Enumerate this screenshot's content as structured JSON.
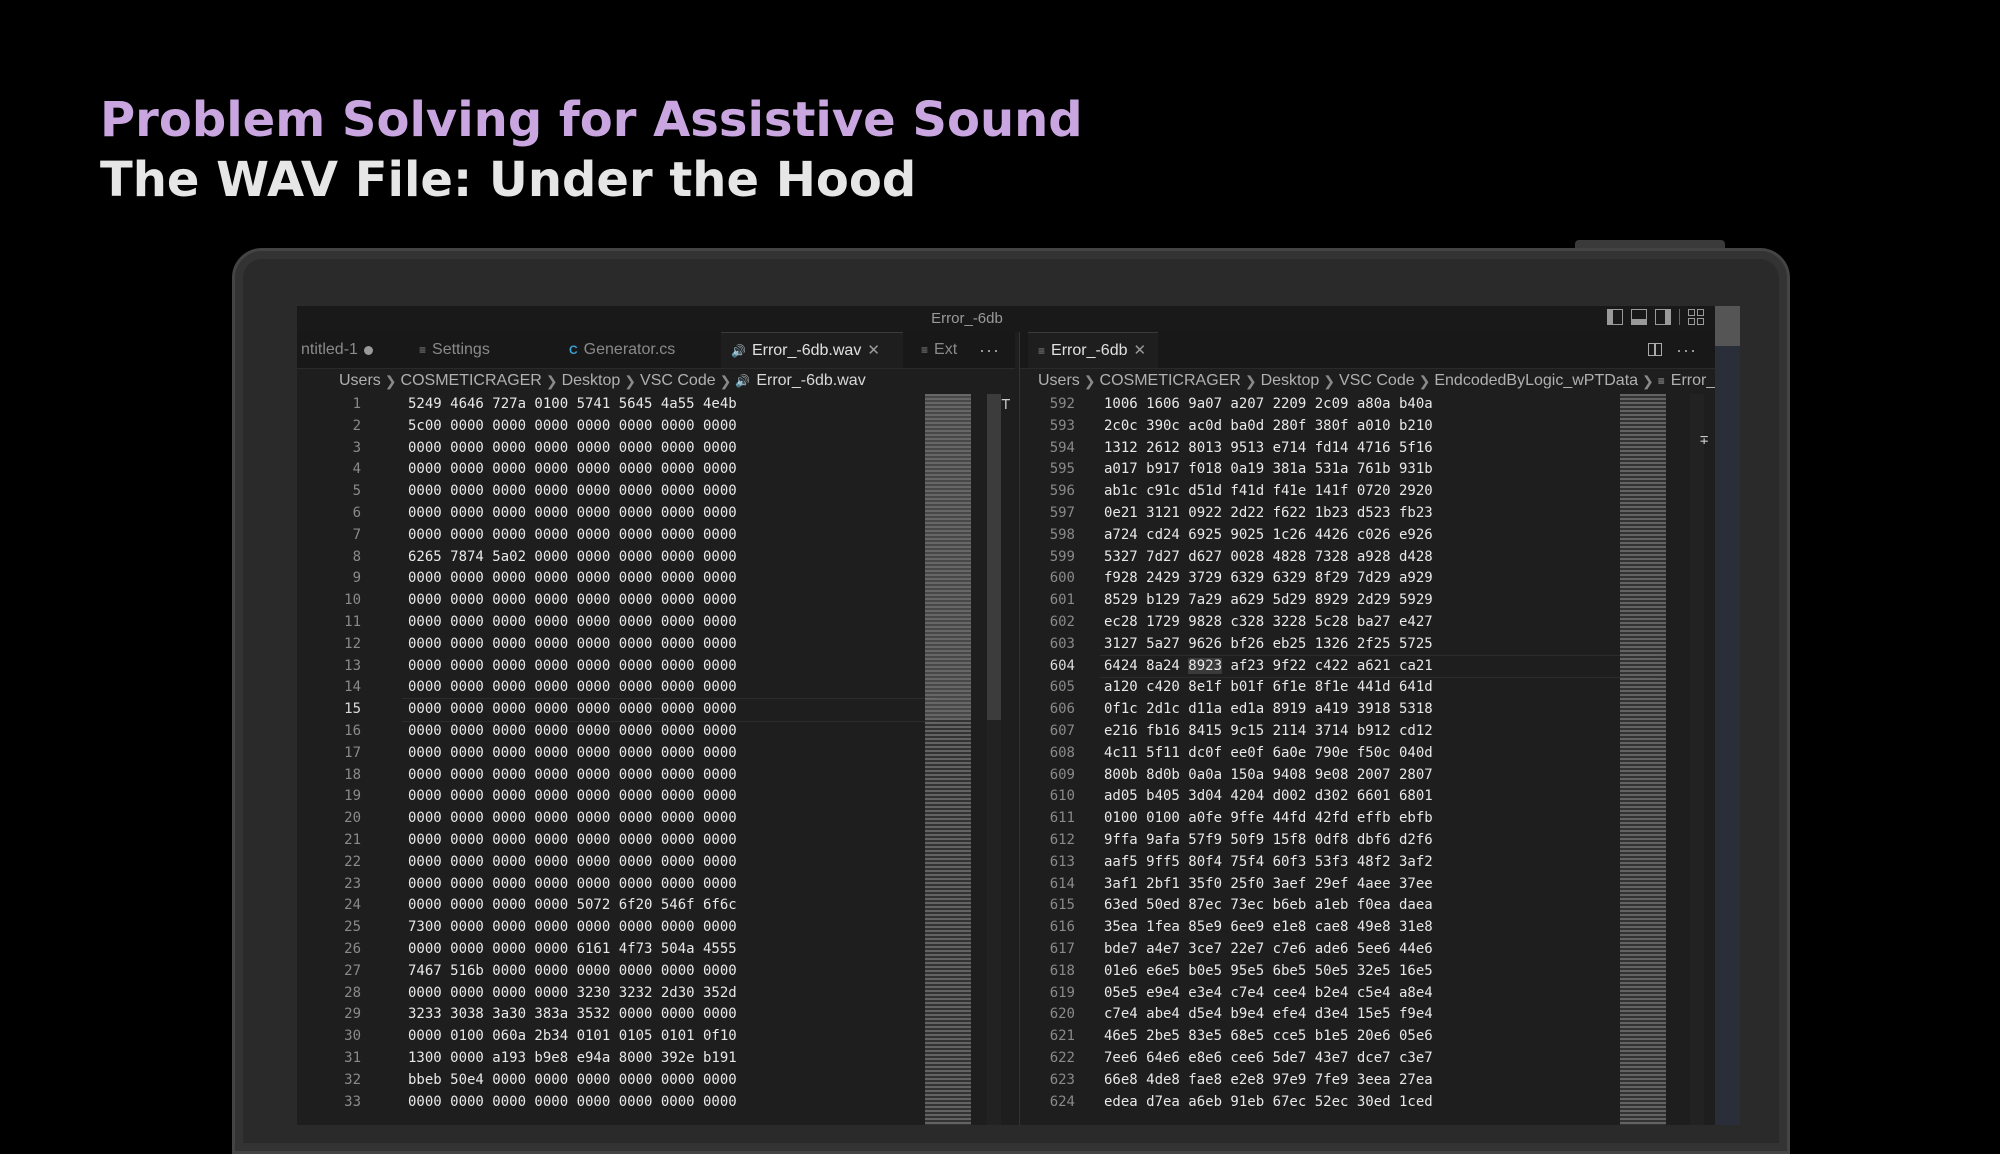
{
  "slide": {
    "title_line1": "Problem Solving for Assistive Sound",
    "title_line2": "The WAV File: Under the Hood"
  },
  "window": {
    "title": "Error_-6db"
  },
  "left_pane": {
    "tabs": [
      {
        "label": "ntitled-1",
        "icon": "unsaved-dot-icon",
        "state": "modified"
      },
      {
        "label": "Settings",
        "icon": "settings-file-icon"
      },
      {
        "label": "Generator.cs",
        "icon": "csharp-icon"
      },
      {
        "label": "Error_-6db.wav",
        "icon": "sound-icon",
        "state": "active"
      },
      {
        "label": "Ext",
        "icon": "file-lines-icon"
      }
    ],
    "more_label": "···",
    "breadcrumb": [
      "Users",
      "COSMETICRAGER",
      "Desktop",
      "VSC Code",
      "Error_-6db.wav"
    ],
    "current_line": 15,
    "lines": [
      {
        "n": "1",
        "text": "5249 4646 727a 0100 5741 5645 4a55 4e4b"
      },
      {
        "n": "2",
        "text": "5c00 0000 0000 0000 0000 0000 0000 0000"
      },
      {
        "n": "3",
        "text": "0000 0000 0000 0000 0000 0000 0000 0000"
      },
      {
        "n": "4",
        "text": "0000 0000 0000 0000 0000 0000 0000 0000"
      },
      {
        "n": "5",
        "text": "0000 0000 0000 0000 0000 0000 0000 0000"
      },
      {
        "n": "6",
        "text": "0000 0000 0000 0000 0000 0000 0000 0000"
      },
      {
        "n": "7",
        "text": "0000 0000 0000 0000 0000 0000 0000 0000"
      },
      {
        "n": "8",
        "text": "6265 7874 5a02 0000 0000 0000 0000 0000"
      },
      {
        "n": "9",
        "text": "0000 0000 0000 0000 0000 0000 0000 0000"
      },
      {
        "n": "10",
        "text": "0000 0000 0000 0000 0000 0000 0000 0000"
      },
      {
        "n": "11",
        "text": "0000 0000 0000 0000 0000 0000 0000 0000"
      },
      {
        "n": "12",
        "text": "0000 0000 0000 0000 0000 0000 0000 0000"
      },
      {
        "n": "13",
        "text": "0000 0000 0000 0000 0000 0000 0000 0000"
      },
      {
        "n": "14",
        "text": "0000 0000 0000 0000 0000 0000 0000 0000"
      },
      {
        "n": "15",
        "text": "0000 0000 0000 0000 0000 0000 0000 0000"
      },
      {
        "n": "16",
        "text": "0000 0000 0000 0000 0000 0000 0000 0000"
      },
      {
        "n": "17",
        "text": "0000 0000 0000 0000 0000 0000 0000 0000"
      },
      {
        "n": "18",
        "text": "0000 0000 0000 0000 0000 0000 0000 0000"
      },
      {
        "n": "19",
        "text": "0000 0000 0000 0000 0000 0000 0000 0000"
      },
      {
        "n": "20",
        "text": "0000 0000 0000 0000 0000 0000 0000 0000"
      },
      {
        "n": "21",
        "text": "0000 0000 0000 0000 0000 0000 0000 0000"
      },
      {
        "n": "22",
        "text": "0000 0000 0000 0000 0000 0000 0000 0000"
      },
      {
        "n": "23",
        "text": "0000 0000 0000 0000 0000 0000 0000 0000"
      },
      {
        "n": "24",
        "text": "0000 0000 0000 0000 5072 6f20 546f 6f6c"
      },
      {
        "n": "25",
        "text": "7300 0000 0000 0000 0000 0000 0000 0000"
      },
      {
        "n": "26",
        "text": "0000 0000 0000 0000 6161 4f73 504a 4555"
      },
      {
        "n": "27",
        "text": "7467 516b 0000 0000 0000 0000 0000 0000"
      },
      {
        "n": "28",
        "text": "0000 0000 0000 0000 3230 3232 2d30 352d"
      },
      {
        "n": "29",
        "text": "3233 3038 3a30 383a 3532 0000 0000 0000"
      },
      {
        "n": "30",
        "text": "0000 0100 060a 2b34 0101 0105 0101 0f10"
      },
      {
        "n": "31",
        "text": "1300 0000 a193 b9e8 e94a 8000 392e b191"
      },
      {
        "n": "32",
        "text": "bbeb 50e4 0000 0000 0000 0000 0000 0000"
      },
      {
        "n": "33",
        "text": "0000 0000 0000 0000 0000 0000 0000 0000"
      }
    ]
  },
  "right_pane": {
    "tabs": [
      {
        "label": "Error_-6db",
        "icon": "file-lines-icon",
        "state": "active"
      }
    ],
    "more_label": "···",
    "breadcrumb": [
      "Users",
      "COSMETICRAGER",
      "Desktop",
      "VSC Code",
      "EndcodedByLogic_wPTData",
      "Error_"
    ],
    "current_line": 604,
    "highlight_word": "8923",
    "lines": [
      {
        "n": "592",
        "text": "1006 1606 9a07 a207 2209 2c09 a80a b40a"
      },
      {
        "n": "593",
        "text": "2c0c 390c ac0d ba0d 280f 380f a010 b210"
      },
      {
        "n": "594",
        "text": "1312 2612 8013 9513 e714 fd14 4716 5f16"
      },
      {
        "n": "595",
        "text": "a017 b917 f018 0a19 381a 531a 761b 931b"
      },
      {
        "n": "596",
        "text": "ab1c c91c d51d f41d f41e 141f 0720 2920"
      },
      {
        "n": "597",
        "text": "0e21 3121 0922 2d22 f622 1b23 d523 fb23"
      },
      {
        "n": "598",
        "text": "a724 cd24 6925 9025 1c26 4426 c026 e926"
      },
      {
        "n": "599",
        "text": "5327 7d27 d627 0028 4828 7328 a928 d428"
      },
      {
        "n": "600",
        "text": "f928 2429 3729 6329 6329 8f29 7d29 a929"
      },
      {
        "n": "601",
        "text": "8529 b129 7a29 a629 5d29 8929 2d29 5929"
      },
      {
        "n": "602",
        "text": "ec28 1729 9828 c328 3228 5c28 ba27 e427"
      },
      {
        "n": "603",
        "text": "3127 5a27 9626 bf26 eb25 1326 2f25 5725"
      },
      {
        "n": "604",
        "text": "6424 8a24 8923 af23 9f22 c422 a621 ca21"
      },
      {
        "n": "605",
        "text": "a120 c420 8e1f b01f 6f1e 8f1e 441d 641d"
      },
      {
        "n": "606",
        "text": "0f1c 2d1c d11a ed1a 8919 a419 3918 5318"
      },
      {
        "n": "607",
        "text": "e216 fb16 8415 9c15 2114 3714 b912 cd12"
      },
      {
        "n": "608",
        "text": "4c11 5f11 dc0f ee0f 6a0e 790e f50c 040d"
      },
      {
        "n": "609",
        "text": "800b 8d0b 0a0a 150a 9408 9e08 2007 2807"
      },
      {
        "n": "610",
        "text": "ad05 b405 3d04 4204 d002 d302 6601 6801"
      },
      {
        "n": "611",
        "text": "0100 0100 a0fe 9ffe 44fd 42fd effb ebfb"
      },
      {
        "n": "612",
        "text": "9ffa 9afa 57f9 50f9 15f8 0df8 dbf6 d2f6"
      },
      {
        "n": "613",
        "text": "aaf5 9ff5 80f4 75f4 60f3 53f3 48f2 3af2"
      },
      {
        "n": "614",
        "text": "3af1 2bf1 35f0 25f0 3aef 29ef 4aee 37ee"
      },
      {
        "n": "615",
        "text": "63ed 50ed 87ec 73ec b6eb a1eb f0ea daea"
      },
      {
        "n": "616",
        "text": "35ea 1fea 85e9 6ee9 e1e8 cae8 49e8 31e8"
      },
      {
        "n": "617",
        "text": "bde7 a4e7 3ce7 22e7 c7e6 ade6 5ee6 44e6"
      },
      {
        "n": "618",
        "text": "01e6 e6e5 b0e5 95e5 6be5 50e5 32e5 16e5"
      },
      {
        "n": "619",
        "text": "05e5 e9e4 e3e4 c7e4 cee4 b2e4 c5e4 a8e4"
      },
      {
        "n": "620",
        "text": "c7e4 abe4 d5e4 b9e4 efe4 d3e4 15e5 f9e4"
      },
      {
        "n": "621",
        "text": "46e5 2be5 83e5 68e5 cce5 b1e5 20e6 05e6"
      },
      {
        "n": "622",
        "text": "7ee6 64e6 e8e6 cee6 5de7 43e7 dce7 c3e7"
      },
      {
        "n": "623",
        "text": "66e8 4de8 fae8 e2e8 97e9 7fe9 3eea 27ea"
      },
      {
        "n": "624",
        "text": "edea d7ea a6eb 91eb 67ec 52ec 30ed 1ced"
      }
    ]
  }
}
